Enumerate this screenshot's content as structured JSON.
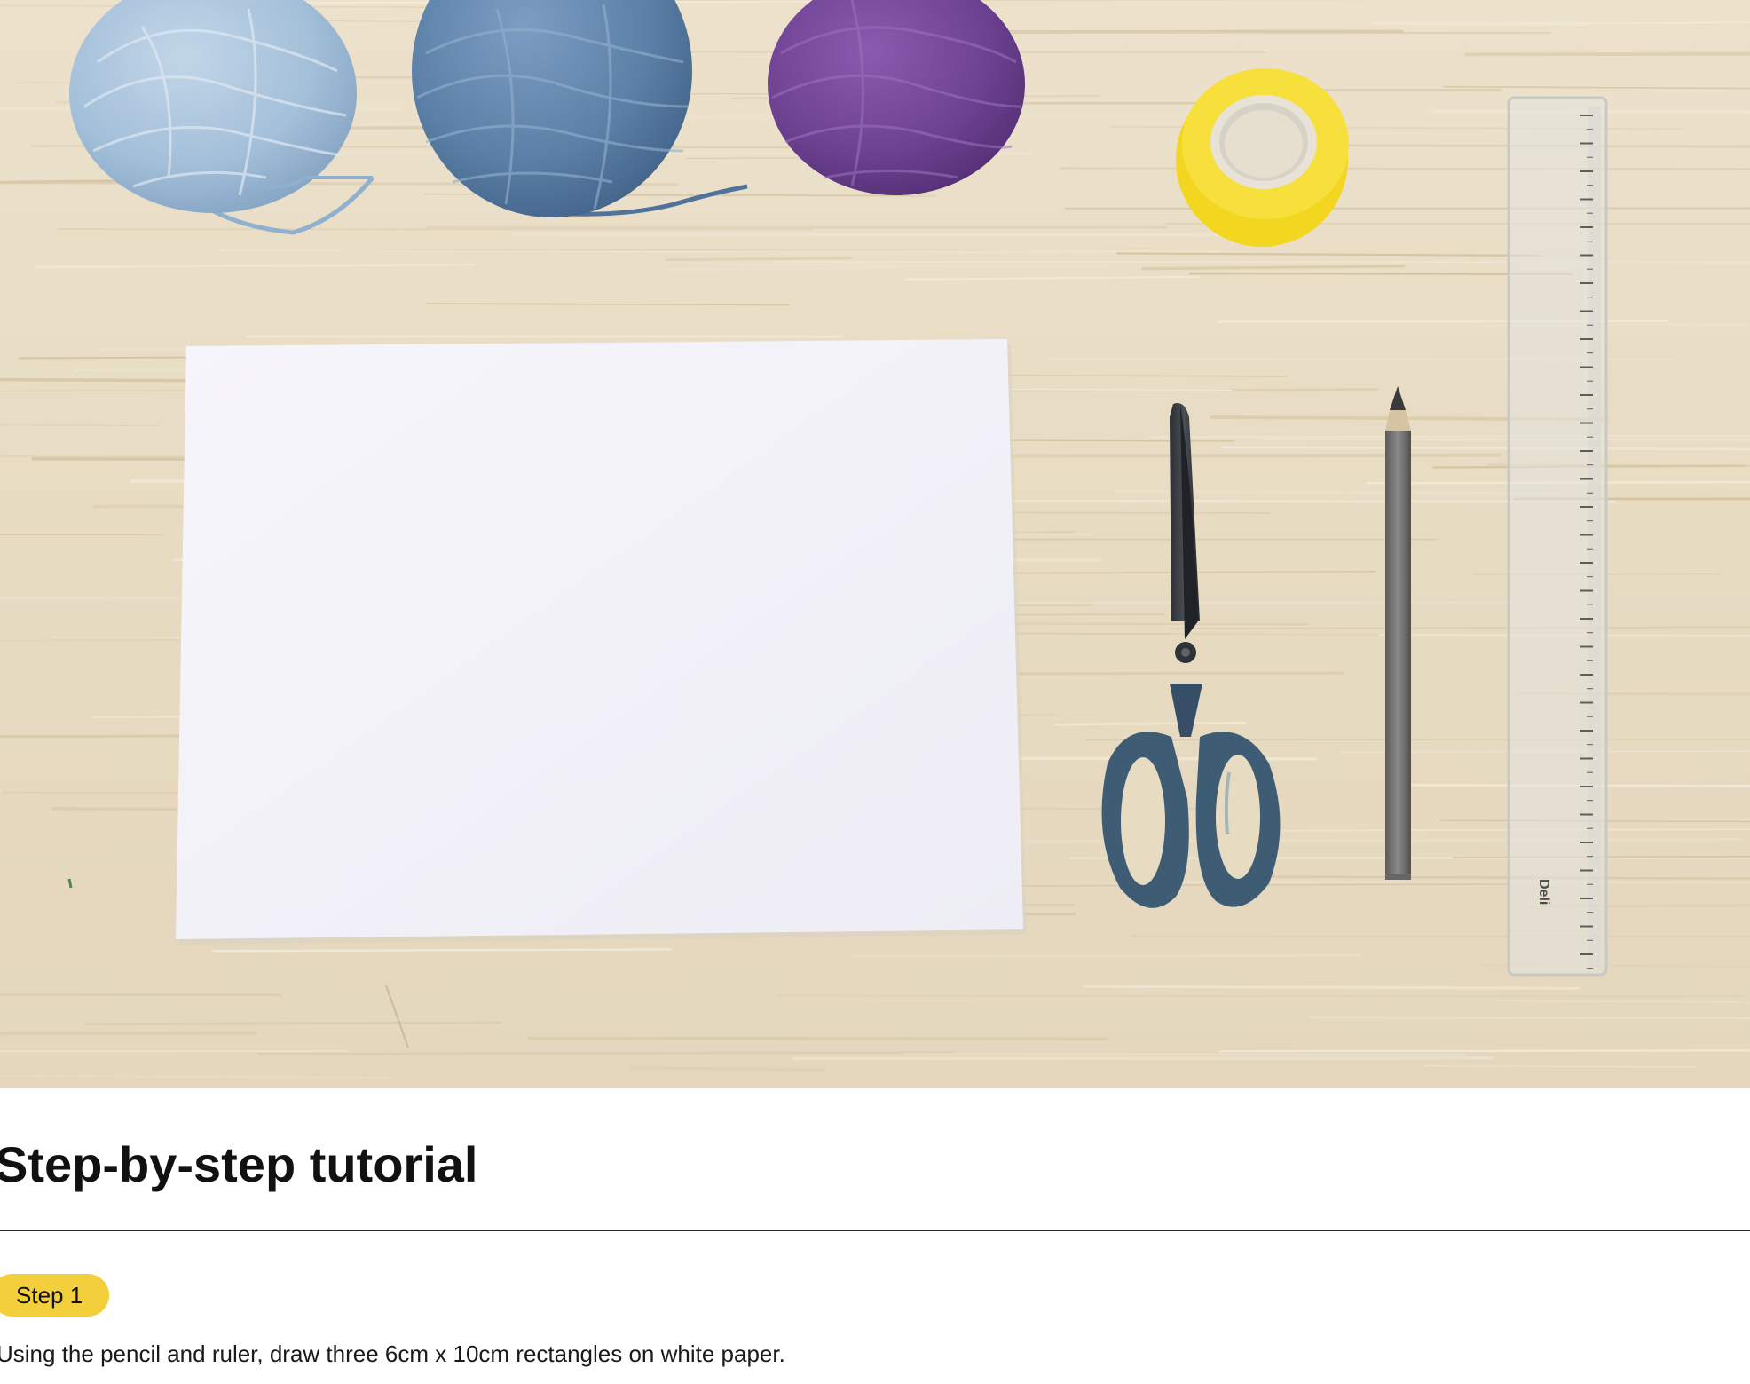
{
  "hero": {
    "alt_subject": "",
    "ruler_brand": "Deli"
  },
  "tutorial": {
    "heading": "Step-by-step tutorial",
    "step_label": "Step 1",
    "step_text": "Using the pencil and ruler, draw three 6cm x 10cm rectangles on white paper."
  },
  "colors": {
    "badge": "#f3cf3b",
    "wood": "#e9dcc4",
    "yarn_light_blue": "#9fbcd6",
    "yarn_blue": "#5b7fa6",
    "yarn_purple": "#6e4292",
    "tape_yellow": "#f2d61f",
    "scissors_handle": "#3e5c74"
  }
}
